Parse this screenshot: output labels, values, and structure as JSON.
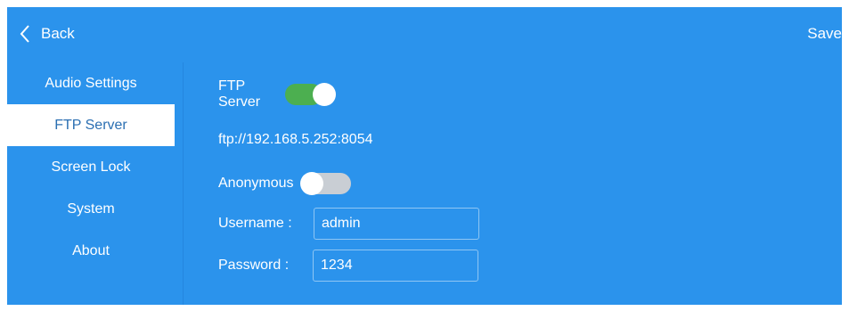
{
  "topbar": {
    "back_label": "Back",
    "save_label": "Save"
  },
  "sidebar": {
    "items": [
      {
        "label": "Audio Settings",
        "active": false
      },
      {
        "label": "FTP Server",
        "active": true
      },
      {
        "label": "Screen Lock",
        "active": false
      },
      {
        "label": "System",
        "active": false
      },
      {
        "label": "About",
        "active": false
      }
    ]
  },
  "ftp": {
    "server_label": "FTP Server",
    "server_enabled": true,
    "url": "ftp://192.168.5.252:8054",
    "anonymous_label": "Anonymous",
    "anonymous_enabled": false,
    "username_label": "Username :",
    "username_value": "admin",
    "password_label": "Password :",
    "password_value": "1234"
  },
  "colors": {
    "background": "#2b93ec",
    "toggle_on": "#4caf50",
    "toggle_off": "#c9ced4",
    "active_item_text": "#2b6fb2"
  }
}
